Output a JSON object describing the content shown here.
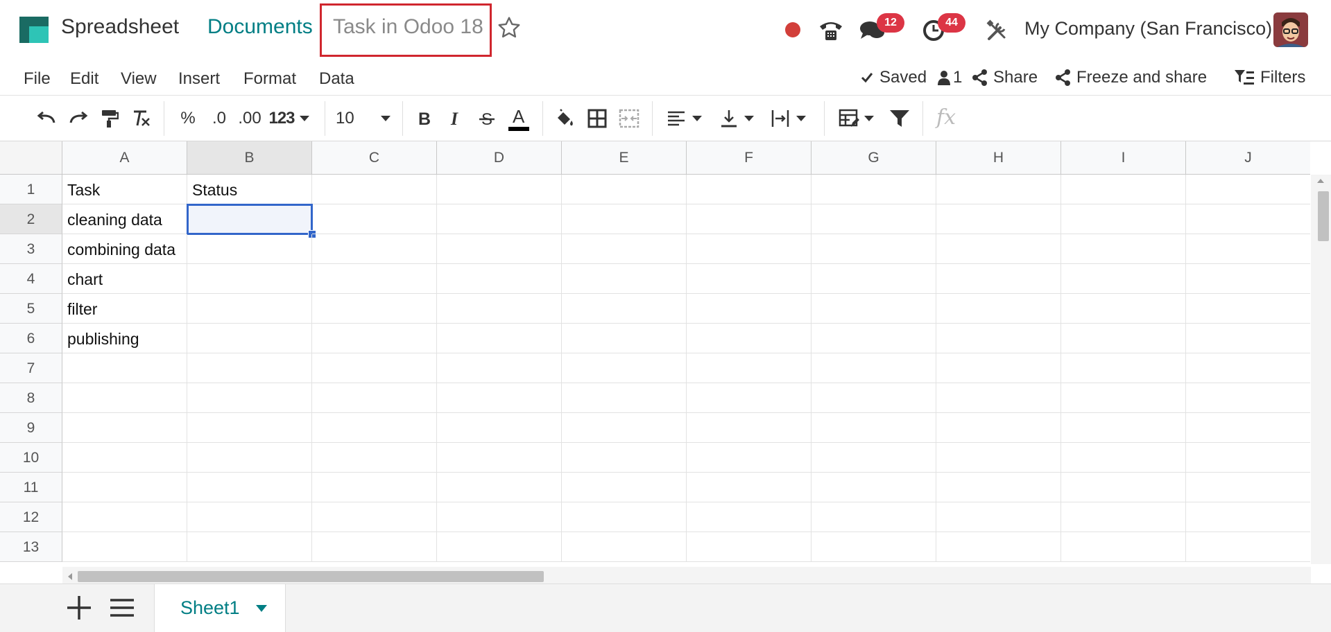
{
  "navbar": {
    "app_name": "Spreadsheet",
    "breadcrumb_parent": "Documents",
    "document_title": "Task in Odoo 18",
    "messages_count": "12",
    "activities_count": "44",
    "company_name": "My Company (San Francisco)"
  },
  "menu": {
    "items": [
      "File",
      "Edit",
      "View",
      "Insert",
      "Format",
      "Data"
    ],
    "saved_label": "Saved",
    "collaborators_count": "1",
    "share_label": "Share",
    "freeze_share_label": "Freeze and share",
    "filters_label": "Filters"
  },
  "toolbar": {
    "percent": "%",
    "decrease_decimal": ".0",
    "increase_decimal": ".00",
    "number_format": "123",
    "font_size": "10",
    "formula_icon": "fx"
  },
  "grid": {
    "columns": [
      "A",
      "B",
      "C",
      "D",
      "E",
      "F",
      "G",
      "H",
      "I",
      "J"
    ],
    "rows": [
      "1",
      "2",
      "3",
      "4",
      "5",
      "6",
      "7",
      "8",
      "9",
      "10",
      "11",
      "12",
      "13"
    ],
    "cells": {
      "A1": "Task",
      "B1": "Status",
      "A2": "cleaning data",
      "A3": "combining data",
      "A4": "chart",
      "A5": "filter",
      "A6": "publishing"
    },
    "selected_cell": "B2"
  },
  "sheets": {
    "active_sheet": "Sheet1"
  },
  "colors": {
    "accent": "#017e84",
    "selection": "#3266ca",
    "badge": "#dc3545",
    "highlight_box": "#d0262e"
  }
}
